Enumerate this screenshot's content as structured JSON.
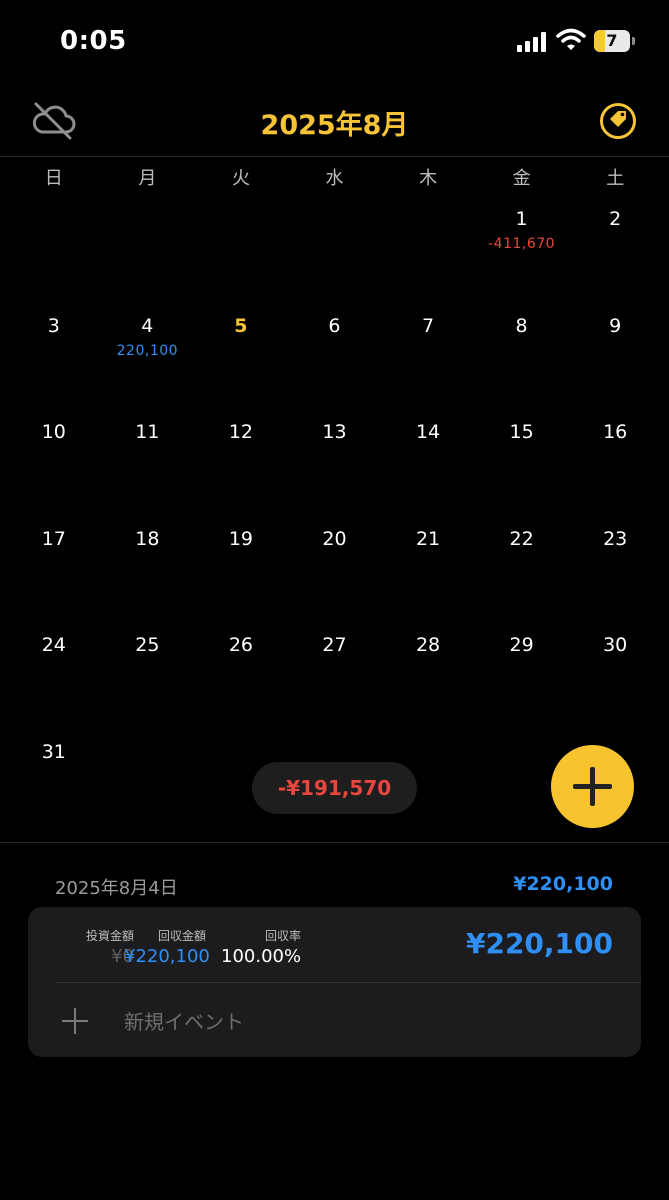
{
  "status_bar": {
    "time": "0:05",
    "battery": "7",
    "battery_level": 0.3
  },
  "header": {
    "title": "2025年8月",
    "cloud_icon": "cloud-off-icon",
    "tag_icon": "tag-icon"
  },
  "weekdays": [
    "日",
    "月",
    "火",
    "水",
    "木",
    "金",
    "土"
  ],
  "calendar": {
    "leading_blanks": 5,
    "days": [
      {
        "day": "1",
        "amount": "-411,670",
        "type": "neg"
      },
      {
        "day": "2"
      },
      {
        "day": "3"
      },
      {
        "day": "4",
        "amount": "220,100",
        "type": "pos",
        "selected": true
      },
      {
        "day": "5",
        "today": true
      },
      {
        "day": "6"
      },
      {
        "day": "7"
      },
      {
        "day": "8"
      },
      {
        "day": "9"
      },
      {
        "day": "10"
      },
      {
        "day": "11"
      },
      {
        "day": "12"
      },
      {
        "day": "13"
      },
      {
        "day": "14"
      },
      {
        "day": "15"
      },
      {
        "day": "16"
      },
      {
        "day": "17"
      },
      {
        "day": "18"
      },
      {
        "day": "19"
      },
      {
        "day": "20"
      },
      {
        "day": "21"
      },
      {
        "day": "22"
      },
      {
        "day": "23"
      },
      {
        "day": "24"
      },
      {
        "day": "25"
      },
      {
        "day": "26"
      },
      {
        "day": "27"
      },
      {
        "day": "28"
      },
      {
        "day": "29"
      },
      {
        "day": "30"
      },
      {
        "day": "31"
      }
    ]
  },
  "month_total": "-¥191,570",
  "add_button_icon": "plus-icon",
  "detail": {
    "date": "2025年8月4日",
    "total": "¥220,100",
    "investment_label": "投資金額",
    "investment_value": "¥0",
    "return_label": "回収金額",
    "return_value": "¥220,100",
    "rate_label": "回収率",
    "rate_value": "100.00%",
    "card_total": "¥220,100",
    "new_event": "新規イベント"
  },
  "colors": {
    "accent": "#f7c438",
    "negative": "#e8463f",
    "positive": "#2f8ff5"
  }
}
